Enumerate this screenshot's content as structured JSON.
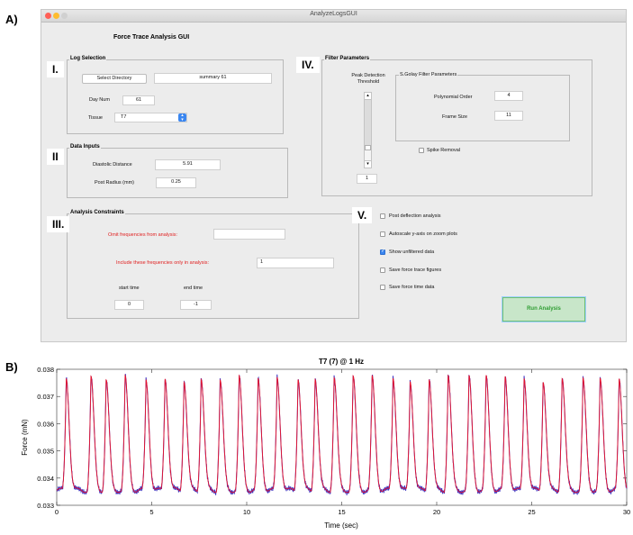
{
  "labels": {
    "a": "A)",
    "b": "B)"
  },
  "window": {
    "title": "AnalyzeLogsGUI",
    "gui_title": "Force Trace Analysis GUI"
  },
  "sections": {
    "log_selection": {
      "title": "Log Selection",
      "marker": "I.",
      "select_directory": "Select Directory",
      "directory_value": "summary 61",
      "day_num_label": "Day Num",
      "day_num_value": "61",
      "tissue_label": "Tissue",
      "tissue_value": "T7"
    },
    "data_inputs": {
      "title": "Data Inputs",
      "marker": "II",
      "diastolic_label": "Diastolic Distance",
      "diastolic_value": "5.91",
      "post_radius_label": "Post Radius (mm)",
      "post_radius_value": "0.25"
    },
    "analysis_constraints": {
      "title": "Analysis Constraints",
      "marker": "III.",
      "omit_label": "Omit frequencies from analysis:",
      "omit_value": "",
      "include_label": "Include these frequencies only in analysis:",
      "include_value": "1",
      "start_label": "start time",
      "start_value": "0",
      "end_label": "end time",
      "end_value": "-1"
    },
    "filter_parameters": {
      "title": "Filter Parameters",
      "marker": "IV.",
      "peak_label_1": "Peak Detection",
      "peak_label_2": "Threshold",
      "threshold_value": "1",
      "sgolay_title": "S.Golay Filter Parameters",
      "poly_label": "Polynomial Order",
      "poly_value": "4",
      "frame_label": "Frame Size",
      "frame_value": "11",
      "spike_label": "Spike Removal"
    },
    "options": {
      "marker": "V.",
      "items": [
        {
          "label": "Post deflection analysis",
          "checked": false
        },
        {
          "label": "Autoscale y-axis on zoom plots",
          "checked": false
        },
        {
          "label": "Show unfiltered data",
          "checked": true
        },
        {
          "label": "Save force trace figures",
          "checked": false
        },
        {
          "label": "Save force time data",
          "checked": false
        }
      ],
      "run_label": "Run Analysis"
    }
  },
  "colors": {
    "raw": "#3b2fbf",
    "filtered": "#e8132b",
    "run_text": "#2e9d32"
  },
  "chart_data": {
    "type": "line",
    "title": "T7 (7) @ 1 Hz",
    "xlabel": "Time (sec)",
    "ylabel": "Force (mN)",
    "xlim": [
      0,
      30
    ],
    "ylim": [
      0.033,
      0.038
    ],
    "xticks": [
      0,
      5,
      10,
      15,
      20,
      25,
      30
    ],
    "yticks": [
      0.033,
      0.034,
      0.035,
      0.036,
      0.037,
      0.038
    ],
    "ytick_labels": [
      "0.033",
      "0.034",
      "0.035",
      "0.036",
      "0.037",
      "0.038"
    ],
    "grid": false,
    "peak_times": [
      0.5,
      1.8,
      2.6,
      3.6,
      4.7,
      5.7,
      6.7,
      7.6,
      8.6,
      9.6,
      10.6,
      11.6,
      12.7,
      13.6,
      14.6,
      15.6,
      16.6,
      17.7,
      18.6,
      19.6,
      20.6,
      21.7,
      22.6,
      23.6,
      24.6,
      25.6,
      26.6,
      27.7,
      28.6,
      29.6
    ],
    "peak_values": [
      0.0377,
      0.0377,
      0.0376,
      0.0377,
      0.0376,
      0.0377,
      0.0376,
      0.0377,
      0.0376,
      0.0377,
      0.0376,
      0.0377,
      0.0377,
      0.0377,
      0.0377,
      0.0377,
      0.0377,
      0.0377,
      0.0376,
      0.0377,
      0.0378,
      0.0377,
      0.0377,
      0.0377,
      0.0377,
      0.0376,
      0.0377,
      0.0376,
      0.0376,
      0.0376
    ],
    "baseline": 0.03355,
    "series": [
      {
        "name": "",
        "color": "#3b2fbf"
      },
      {
        "name": "",
        "color": "#e8132b"
      }
    ]
  }
}
